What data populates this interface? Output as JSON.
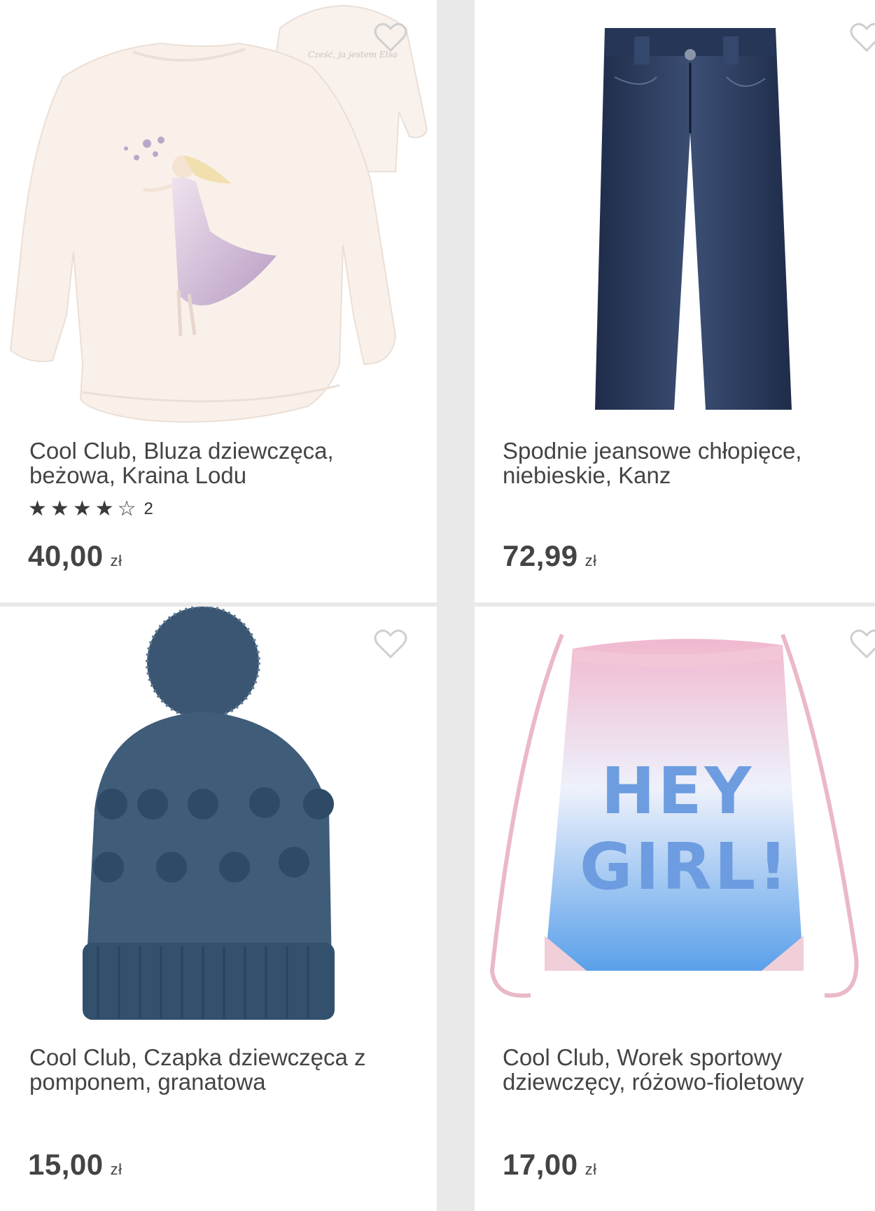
{
  "products": [
    {
      "title_line1": "Cool Club, Bluza dziewczęca,",
      "title_line2": "beżowa, Kraina Lodu",
      "rating_stars": 4,
      "rating_max": 5,
      "rating_count": "2",
      "price": "40,00",
      "currency": "zł",
      "image_text": "Cześć, ja jestem Elsa"
    },
    {
      "title_line1": "Spodnie jeansowe chłopięce,",
      "title_line2": "niebieskie, Kanz",
      "price": "72,99",
      "currency": "zł"
    },
    {
      "title_line1": "Cool Club, Czapka dziewczęca z",
      "title_line2": "pomponem, granatowa",
      "price": "15,00",
      "currency": "zł"
    },
    {
      "title_line1": "Cool Club, Worek sportowy",
      "title_line2": "dziewczęcy, różowo-fioletowy",
      "price": "17,00",
      "currency": "zł",
      "image_text_line1": "HEY",
      "image_text_line2": "GIRL!"
    }
  ],
  "icons": {
    "favorite": "heart-outline-icon",
    "star_full": "star-filled-icon",
    "star_empty": "star-outline-icon"
  },
  "colors": {
    "background": "#e9e9e9",
    "card": "#ffffff",
    "text": "#444444",
    "price": "#444444"
  }
}
